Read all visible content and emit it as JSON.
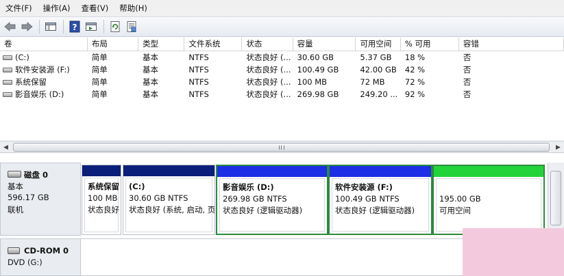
{
  "menu": [
    "文件(F)",
    "操作(A)",
    "查看(V)",
    "帮助(H)"
  ],
  "toolbar": {
    "icons": [
      "back-arrow-icon",
      "forward-arrow-icon",
      "console-tree-icon",
      "help-icon",
      "show-hide-icon",
      "refresh-icon",
      "properties-icon"
    ],
    "help_glyph": "?"
  },
  "table": {
    "columns": [
      "卷",
      "布局",
      "类型",
      "文件系统",
      "状态",
      "容量",
      "可用空间",
      "% 可用",
      "容错"
    ],
    "rows": [
      {
        "volume": "(C:)",
        "layout": "简单",
        "type": "基本",
        "fs": "NTFS",
        "status": "状态良好 (...",
        "capacity": "30.60 GB",
        "free": "5.37 GB",
        "pct": "18 %",
        "fault": "否"
      },
      {
        "volume": "软件安装源 (F:)",
        "layout": "简单",
        "type": "基本",
        "fs": "NTFS",
        "status": "状态良好 (...",
        "capacity": "100.49 GB",
        "free": "42.00 GB",
        "pct": "42 %",
        "fault": "否"
      },
      {
        "volume": "系统保留",
        "layout": "简单",
        "type": "基本",
        "fs": "NTFS",
        "status": "状态良好 (...",
        "capacity": "100 MB",
        "free": "72 MB",
        "pct": "72 %",
        "fault": "否"
      },
      {
        "volume": "影音娱乐 (D:)",
        "layout": "简单",
        "type": "基本",
        "fs": "NTFS",
        "status": "状态良好 (...",
        "capacity": "269.98 GB",
        "free": "249.20 ...",
        "pct": "92 %",
        "fault": "否"
      }
    ]
  },
  "disk0": {
    "name": "磁盘 0",
    "type": "基本",
    "size": "596.17 GB",
    "state": "联机",
    "partitions": [
      {
        "name": "系统保留",
        "size": "100 MB",
        "status": "状态良好",
        "bar_color": "#0a1f7a"
      },
      {
        "name": "(C:)",
        "size": "30.60 GB NTFS",
        "status": "状态良好 (系统, 启动, 页",
        "bar_color": "#0a1f7a"
      },
      {
        "name": "影音娱乐  (D:)",
        "size": "269.98 GB NTFS",
        "status": "状态良好 (逻辑驱动器)",
        "bar_color": "#1c2ee6"
      },
      {
        "name": "软件安装源  (F:)",
        "size": "100.49 GB NTFS",
        "status": "状态良好 (逻辑驱动器)",
        "bar_color": "#1c2ee6"
      },
      {
        "name": "",
        "size": "195.00 GB",
        "status": "可用空间",
        "bar_color": "#22d43a"
      }
    ]
  },
  "cdrom0": {
    "name": "CD-ROM 0",
    "type": "DVD (G:)"
  },
  "scrollbar": {
    "grip": "III",
    "left_arrow": "◀",
    "right_arrow": "▶"
  }
}
